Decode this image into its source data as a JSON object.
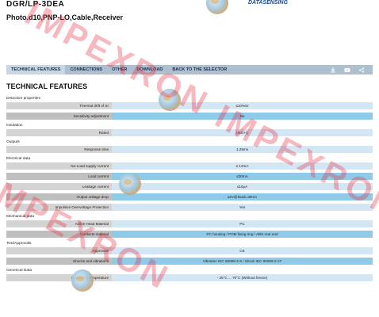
{
  "header": {
    "product_code": "DGR/LP-3DEA",
    "product_desc": "Photo.d10,PNP-LO,Cable,Receiver",
    "brand": "DATASENSING"
  },
  "nav": {
    "tabs": [
      "TECHNICAL FEATURES",
      "CONNECTIONS",
      "OTHER",
      "DOWNLOAD",
      "BACK TO THE SELECTOR"
    ],
    "icons": [
      "download-icon",
      "video-icon",
      "share-icon"
    ]
  },
  "section_title": "TECHNICAL FEATURES",
  "groups": [
    {
      "title": "Detection properties",
      "rows": [
        {
          "label": "Thermal drift of Sr",
          "value": "≤10%Sr"
        },
        {
          "label": "Sensitivity adjustment",
          "value": "No"
        }
      ]
    },
    {
      "title": "Insulation",
      "rows": [
        {
          "label": "Rated",
          "value": "(IEG+I)"
        }
      ]
    },
    {
      "title": "Outputs",
      "rows": [
        {
          "label": "Response time",
          "value": "1.25ms"
        }
      ]
    },
    {
      "title": "Electrical data",
      "rows": [
        {
          "label": "No-Load supply current",
          "value": "≤ 12mA"
        },
        {
          "label": "Load current",
          "value": "≤30mA"
        },
        {
          "label": "Leakage current",
          "value": "≤10μA"
        },
        {
          "label": "Output voltage drop",
          "value": "≤2V@Iload=30mA"
        },
        {
          "label": "Impulsive Overvoltage Protection",
          "value": "Yes"
        }
      ]
    },
    {
      "title": "Mechanical data",
      "rows": [
        {
          "label": "Active Head Material",
          "value": "PC"
        },
        {
          "label": "Contacts material",
          "value": "PC housing / POM fixing ring / ABS rear end"
        }
      ]
    },
    {
      "title": "Test/Approvals",
      "rows": [
        {
          "label": "Approvals",
          "value": "CE"
        },
        {
          "label": "Shocks and vibrations",
          "value": "Vibration IEC 60068-2-6 / Shock IEC 60068-2-27"
        }
      ]
    },
    {
      "title": "Generical Data",
      "rows": [
        {
          "label": "Operating Temperature",
          "value": "- 25°C ... 70°C (Without freeze)"
        }
      ]
    }
  ],
  "watermark_text": "IMPEXRON",
  "colors": {
    "nav_bg": "#aebfd0",
    "label_bg": "#d4d4d4",
    "value_bg": "#d3e6f4",
    "value_alt_bg": "#8fcbe9",
    "watermark": "#e6283c"
  }
}
